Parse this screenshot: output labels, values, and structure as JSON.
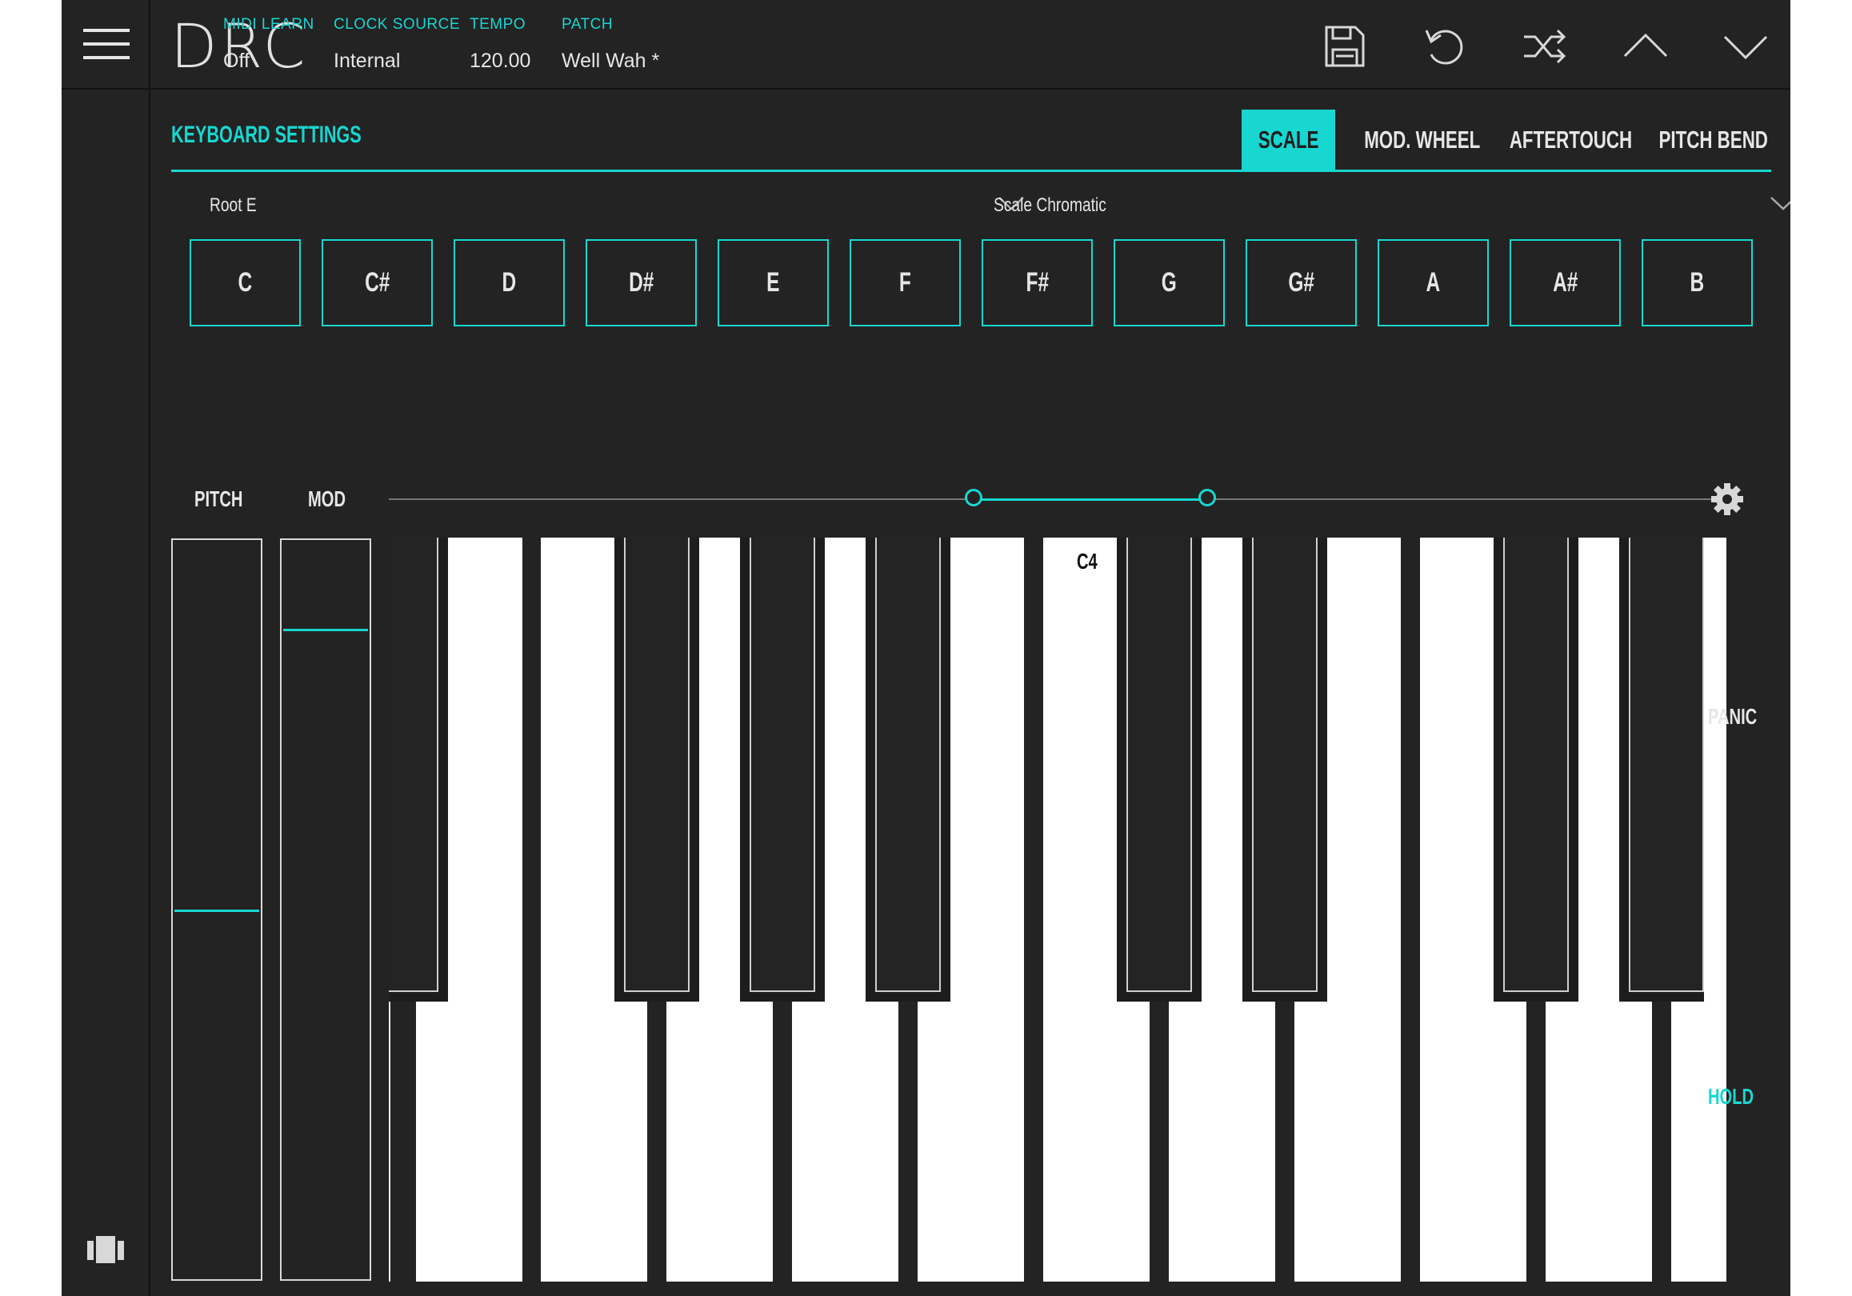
{
  "app": {
    "logo": "DRC",
    "accent": "#18d6d0",
    "background": "#232323"
  },
  "header": {
    "fields": [
      {
        "label": "MIDI LEARN",
        "value": "Off"
      },
      {
        "label": "CLOCK SOURCE",
        "value": "Internal"
      },
      {
        "label": "TEMPO",
        "value": "120.00"
      },
      {
        "label": "PATCH",
        "value": "Well Wah *"
      }
    ],
    "icons": [
      "save-icon",
      "undo-icon",
      "shuffle-icon",
      "chevron-up-icon",
      "chevron-down-icon"
    ]
  },
  "section": {
    "title": "KEYBOARD SETTINGS"
  },
  "tabs": [
    {
      "label": "SCALE",
      "active": true
    },
    {
      "label": "MOD. WHEEL"
    },
    {
      "label": "AFTERTOUCH"
    },
    {
      "label": "PITCH BEND"
    }
  ],
  "dropdowns": {
    "root": {
      "label": "Root E"
    },
    "scale": {
      "label": "Scale Chromatic"
    }
  },
  "notes": [
    "C",
    "C#",
    "D",
    "D#",
    "E",
    "F",
    "F#",
    "G",
    "G#",
    "A",
    "A#",
    "B"
  ],
  "wheels": {
    "pitch": {
      "label": "PITCH",
      "value": 0.5
    },
    "mod": {
      "label": "MOD",
      "value": 0.88
    }
  },
  "keyboard": {
    "octave_label": "C4"
  },
  "side_buttons": {
    "panic": "PANIC",
    "hold": "HOLD"
  }
}
